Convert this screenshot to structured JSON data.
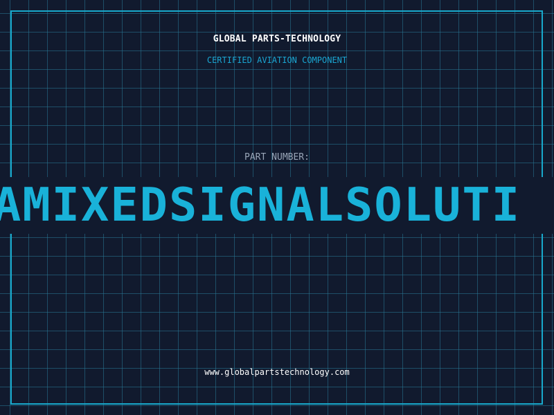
{
  "header": {
    "company": "GLOBAL PARTS-TECHNOLOGY",
    "tagline": "CERTIFIED AVIATION COMPONENT"
  },
  "part": {
    "label": "PART NUMBER:",
    "number": "AMIXEDSIGNALSOLUTI"
  },
  "footer": {
    "url": "www.globalpartstechnology.com"
  },
  "colors": {
    "background": "#111a2e",
    "grid": "#287896",
    "accent": "#19b2d9",
    "text": "#ffffff",
    "muted": "#9aa6b8"
  }
}
